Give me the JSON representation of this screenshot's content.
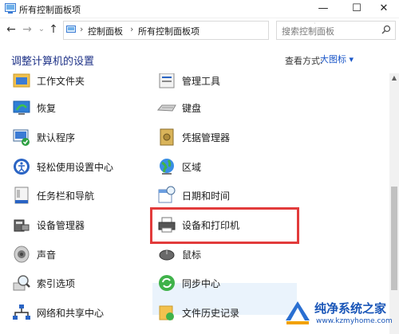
{
  "window": {
    "title": "所有控制面板项",
    "minimize": "—",
    "maximize": "☐",
    "close": "✕"
  },
  "nav": {
    "back": "←",
    "forward": "→",
    "dropdown": "⌄",
    "up": "↑"
  },
  "address": {
    "crumbs": [
      "控制面板",
      "所有控制面板项"
    ],
    "separator": "›",
    "refresh": "↻",
    "dropdown": "⌄"
  },
  "search": {
    "placeholder": "搜索控制面板"
  },
  "header": {
    "title": "调整计算机的设置",
    "view_by_label": "查看方式:",
    "view_by_value": "大图标 ▾"
  },
  "items": {
    "left": [
      "工作文件夹",
      "恢复",
      "默认程序",
      "轻松使用设置中心",
      "任务栏和导航",
      "设备管理器",
      "声音",
      "索引选项",
      "网络和共享中心"
    ],
    "right": [
      "管理工具",
      "键盘",
      "凭据管理器",
      "区域",
      "日期和时间",
      "设备和打印机",
      "鼠标",
      "同步中心",
      "文件历史记录"
    ]
  },
  "selected_item": "设备和打印机",
  "highlight_color": "#e23b3b",
  "watermark": {
    "text": "纯净系统之家",
    "url": "www.kzmyhome.com"
  }
}
